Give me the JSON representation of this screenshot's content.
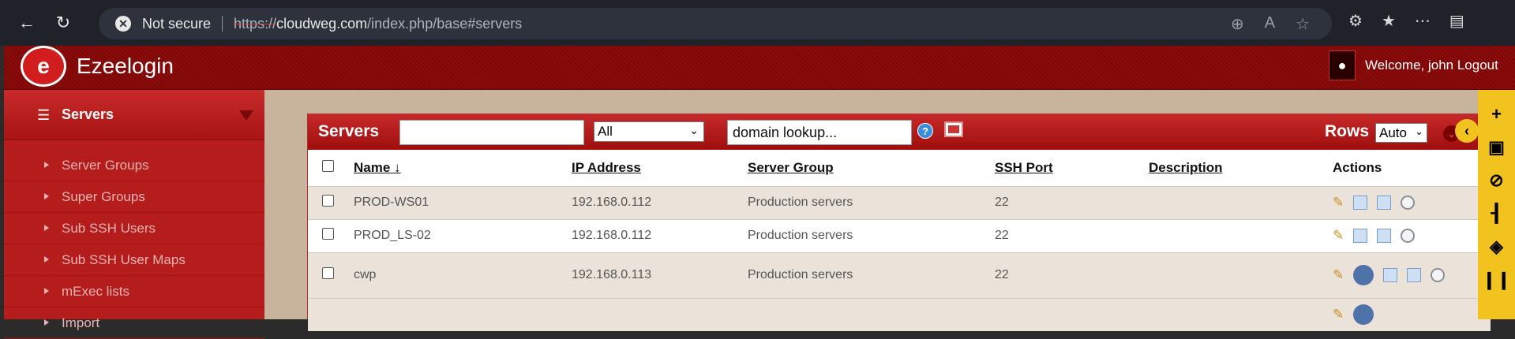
{
  "browser": {
    "security_label": "Not secure",
    "url_protocol": "https://",
    "url_host": "cloudweg.com",
    "url_path": "/index.php/base#servers"
  },
  "header": {
    "brand": "Ezeelogin",
    "welcome": "Welcome, john Logout"
  },
  "sidebar": {
    "title": "Servers",
    "items": [
      {
        "label": "Server Groups"
      },
      {
        "label": "Super Groups"
      },
      {
        "label": "Sub SSH Users"
      },
      {
        "label": "Sub SSH User Maps"
      },
      {
        "label": "mExec lists"
      },
      {
        "label": "Import"
      }
    ]
  },
  "toolbar": {
    "title": "Servers",
    "search_value": "",
    "filter_selected": "All",
    "lookup_value": "domain lookup...",
    "help": "?",
    "rows_label": "Rows",
    "rows_selected": "Auto"
  },
  "table": {
    "columns": [
      "Name",
      "IP Address",
      "Server Group",
      "SSH Port",
      "Description",
      "Actions"
    ],
    "sort_indicator": "↓",
    "rows": [
      {
        "name": "PROD-WS01",
        "ip": "192.168.0.112",
        "group": "Production servers",
        "ssh_port": "22",
        "description": ""
      },
      {
        "name": "PROD_LS-02",
        "ip": "192.168.0.112",
        "group": "Production servers",
        "ssh_port": "22",
        "description": ""
      },
      {
        "name": "cwp",
        "ip": "192.168.0.113",
        "group": "Production servers",
        "ssh_port": "22",
        "description": ""
      }
    ]
  },
  "colors": {
    "header_red": "#8d0c0c",
    "sidebar_red": "#b51c1c",
    "row_alt": "#ebe3d9",
    "strip_yellow": "#f2c21f"
  }
}
